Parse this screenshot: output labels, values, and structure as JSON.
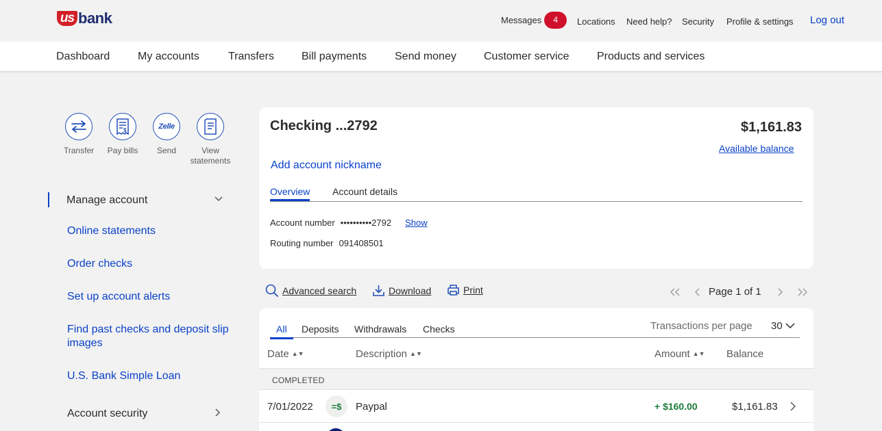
{
  "header": {
    "logo": {
      "us": "us",
      "bank": "bank"
    },
    "utility": {
      "messages_label": "Messages",
      "messages_count": "4",
      "locations": "Locations",
      "need_help": "Need help?",
      "security": "Security",
      "profile": "Profile & settings",
      "logout": "Log out"
    }
  },
  "nav": {
    "items": [
      "Dashboard",
      "My accounts",
      "Transfers",
      "Bill payments",
      "Send money",
      "Customer service",
      "Products and services"
    ]
  },
  "quick_actions": [
    {
      "label": "Transfer",
      "icon": "transfer-arrows-icon"
    },
    {
      "label": "Pay bills",
      "icon": "bill-icon"
    },
    {
      "label": "Send",
      "icon": "zelle-icon",
      "glyph": "Zelle"
    },
    {
      "label": "View statements",
      "icon": "statement-icon"
    }
  ],
  "sidebar": {
    "manage_heading": "Manage account",
    "links": [
      "Online statements",
      "Order checks",
      "Set up account alerts",
      "Find past checks and deposit slip images",
      "U.S. Bank Simple Loan"
    ],
    "security_heading": "Account security"
  },
  "account": {
    "title": "Checking ...2792",
    "balance": "$1,161.83",
    "available_balance_link": "Available balance",
    "add_nickname": "Add account nickname",
    "tabs": [
      "Overview",
      "Account details"
    ],
    "account_number_label": "Account number",
    "account_number_value": "••••••••••2792",
    "show_link": "Show",
    "routing_number_label": "Routing number",
    "routing_number_value": "091408501"
  },
  "toolbar": {
    "advanced_search": "Advanced search",
    "download": "Download",
    "print": "Print",
    "page_label": "Page 1 of 1"
  },
  "transactions": {
    "filter_tabs": [
      "All",
      "Deposits",
      "Withdrawals",
      "Checks"
    ],
    "per_page_label": "Transactions per page",
    "per_page_value": "30",
    "columns": {
      "date": "Date",
      "description": "Description",
      "amount": "Amount",
      "balance": "Balance"
    },
    "section_label": "COMPLETED",
    "rows": [
      {
        "date": "7/01/2022",
        "icon_glyph": "=$",
        "description": "Paypal",
        "amount": "+ $160.00",
        "balance": "$1,161.83"
      }
    ]
  },
  "colors": {
    "brand_blue": "#0a41c9",
    "brand_red": "#d22027",
    "positive_green": "#1e7c3b"
  }
}
